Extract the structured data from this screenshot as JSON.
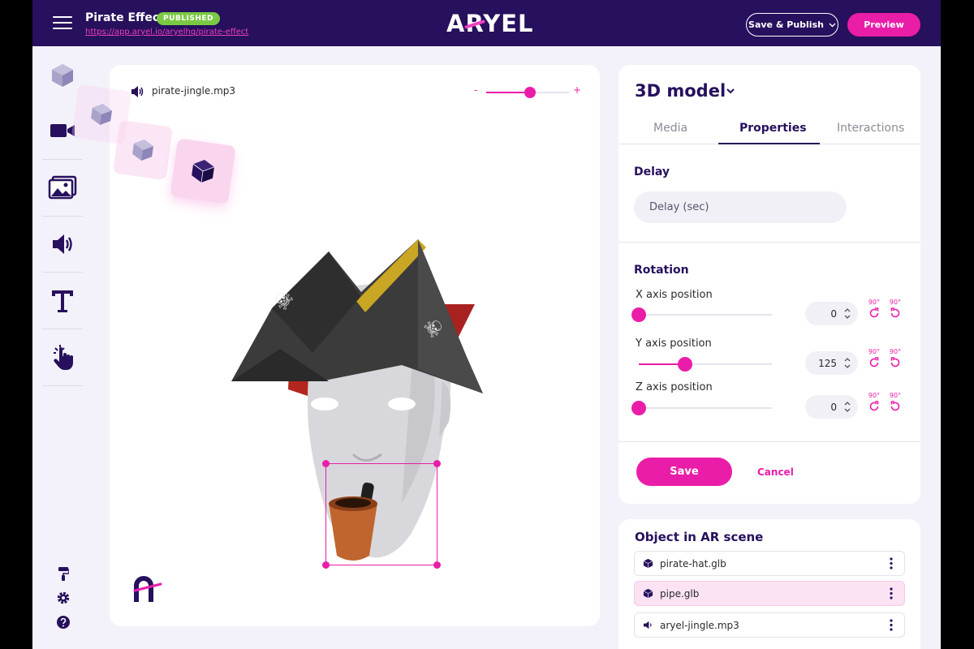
{
  "header": {
    "project_title": "Pirate Effect",
    "status_badge": "PUBLISHED",
    "project_url": "https://app.aryel.io/aryelhq/pirate-effect",
    "logo_text": "ARYEL",
    "save_publish_label": "Save & Publish",
    "preview_label": "Preview"
  },
  "sidebar": {
    "items": [
      "3d-object",
      "video",
      "image",
      "audio",
      "text",
      "interaction"
    ],
    "active": "3d-object",
    "bottom_tools": [
      "paint-roller",
      "settings",
      "help"
    ]
  },
  "canvas": {
    "audio_file": "pirate-jingle.mp3",
    "volume_minus": "-",
    "volume_plus": "+",
    "volume_level": 0.53
  },
  "properties": {
    "model_type": "3D model",
    "tabs": [
      "Media",
      "Properties",
      "Interactions"
    ],
    "active_tab": "Properties",
    "delay_title": "Delay",
    "delay_placeholder": "Delay (sec)",
    "rotation_title": "Rotation",
    "axes": [
      {
        "label": "X axis position",
        "value": "0",
        "slider": 0.0
      },
      {
        "label": "Y axis position",
        "value": "125",
        "slider": 0.35
      },
      {
        "label": "Z axis position",
        "value": "0",
        "slider": 0.0
      }
    ],
    "rotate_cw_label": "90°",
    "rotate_ccw_label": "90°",
    "save_label": "Save",
    "cancel_label": "Cancel"
  },
  "objects": {
    "title": "Object in AR scene",
    "items": [
      {
        "name": "pirate-hat.glb",
        "icon": "cube-icon",
        "selected": false
      },
      {
        "name": "pipe.glb",
        "icon": "cube-icon",
        "selected": true
      },
      {
        "name": "aryel-jingle.mp3",
        "icon": "speaker-icon",
        "selected": false
      }
    ]
  },
  "colors": {
    "header_bg": "#27105d",
    "accent": "#ea1da9",
    "badge_green": "#7ac943",
    "panel_bg": "#f3f2fa"
  }
}
